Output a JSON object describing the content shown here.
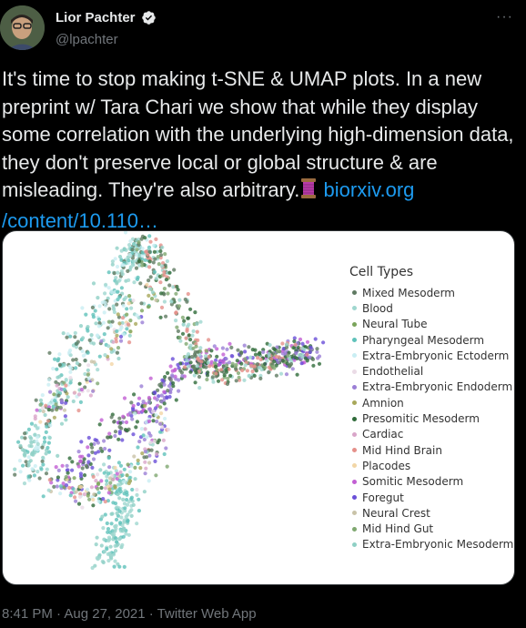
{
  "author": {
    "display_name": "Lior Pachter",
    "handle": "@lpachter",
    "verified_icon": "verified-badge-icon"
  },
  "more_icon": "···",
  "tweet": {
    "text": "It's time to stop making t-SNE & UMAP plots. In a new preprint w/ Tara Chari we show that while they display some correlation with the underlying high-dimension data, they don't preserve local or global structure & are misleading. They're also arbitrary.",
    "link_text_1": "biorxiv.org",
    "link_text_2": "/content/10.110…",
    "spool_icon": "thread-spool-emoji"
  },
  "media": {
    "legend_title": "Cell Types",
    "legend": [
      {
        "label": "Mixed Mesoderm",
        "color": "#5f7a62"
      },
      {
        "label": "Blood",
        "color": "#9fd7cf"
      },
      {
        "label": "Neural Tube",
        "color": "#7aa45a"
      },
      {
        "label": "Pharyngeal Mesoderm",
        "color": "#5fc2ba"
      },
      {
        "label": "Extra-Embryonic Ectoderm",
        "color": "#c9eef3"
      },
      {
        "label": "Endothelial",
        "color": "#eadbe6"
      },
      {
        "label": "Extra-Embryonic Endoderm",
        "color": "#9b7fd6"
      },
      {
        "label": "Amnion",
        "color": "#a8a85a"
      },
      {
        "label": "Presomitic Mesoderm",
        "color": "#2f6b3a"
      },
      {
        "label": "Cardiac",
        "color": "#d9a6c9"
      },
      {
        "label": "Mid Hind Brain",
        "color": "#e5908a"
      },
      {
        "label": "Placodes",
        "color": "#f2d6a6"
      },
      {
        "label": "Somitic Mesoderm",
        "color": "#c25fd3"
      },
      {
        "label": "Foregut",
        "color": "#6a4fd8"
      },
      {
        "label": "Neural Crest",
        "color": "#c9c3a8"
      },
      {
        "label": "Mid Hind Gut",
        "color": "#7fa870"
      },
      {
        "label": "Extra-Embryonic Mesoderm",
        "color": "#8fd0c5"
      }
    ]
  },
  "timestamp": "8:41 PM · Aug 27, 2021 · Twitter Web App"
}
